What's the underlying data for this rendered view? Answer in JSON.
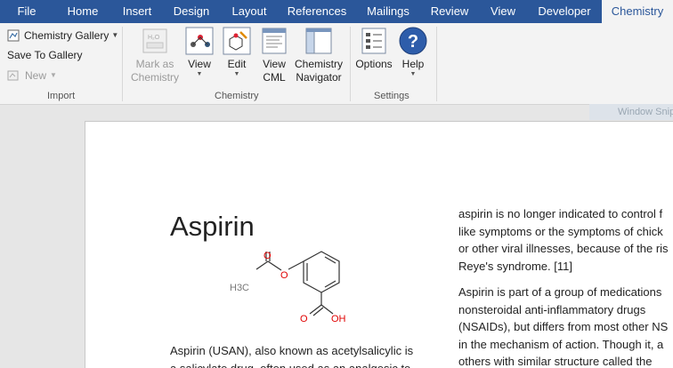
{
  "tabs": [
    {
      "label": "File"
    },
    {
      "label": "Home"
    },
    {
      "label": "Insert"
    },
    {
      "label": "Design"
    },
    {
      "label": "Layout"
    },
    {
      "label": "References"
    },
    {
      "label": "Mailings"
    },
    {
      "label": "Review"
    },
    {
      "label": "View"
    },
    {
      "label": "Developer"
    },
    {
      "label": "Chemistry",
      "active": true
    }
  ],
  "ribbon": {
    "import": {
      "label": "Import",
      "chemistry_gallery": "Chemistry Gallery",
      "save_to_gallery": "Save To Gallery",
      "new": "New"
    },
    "chemistry": {
      "label": "Chemistry",
      "mark_as_chemistry": [
        "Mark as",
        "Chemistry"
      ],
      "view": "View",
      "edit": "Edit",
      "view_cml": [
        "View",
        "CML"
      ],
      "chemistry_navigator": [
        "Chemistry",
        "Navigator"
      ]
    },
    "settings": {
      "label": "Settings",
      "options": "Options",
      "help": "Help"
    }
  },
  "window_snip": "Window Snip",
  "document": {
    "title": "Aspirin",
    "molecule_labels": {
      "methyl": "H3C",
      "o_carbonyl": "O",
      "o_ester": "O",
      "o_acid": "O",
      "oh": "OH"
    },
    "left_column": [
      "Aspirin (USAN), also known as acetylsalicylic is",
      "a salicylate drug, often used as an analgesic to"
    ],
    "right_column_para1": [
      "aspirin is no longer indicated to control f",
      "like symptoms or the symptoms of chick",
      "or other viral illnesses, because of the ris",
      "Reye's syndrome. [11]"
    ],
    "right_column_para2": [
      "Aspirin is part of a group of medications",
      "nonsteroidal anti-inflammatory drugs",
      "(NSAIDs), but differs from most other NS",
      "in the mechanism of action. Though it, a",
      "others with similar structure called the"
    ]
  },
  "colors": {
    "tab_bar": "#2b579a",
    "ribbon": "#f3f3f3",
    "oxygen": "#e00000",
    "help_icon": "#2e5daa"
  }
}
